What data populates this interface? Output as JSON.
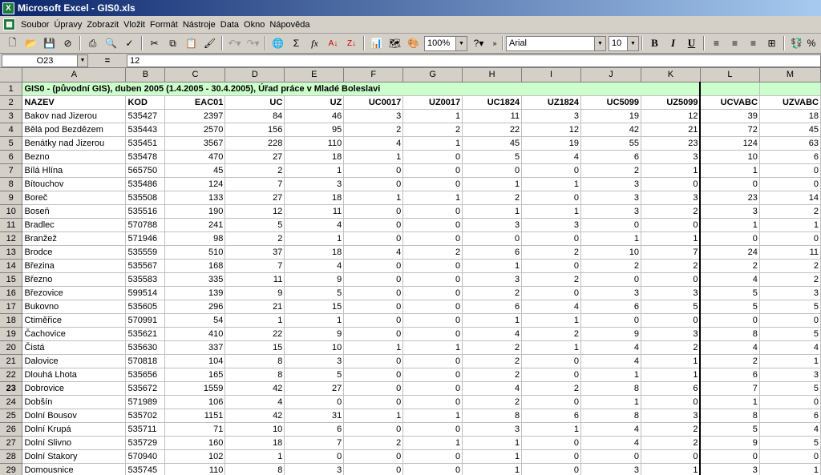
{
  "window": {
    "title": "Microsoft Excel - GIS0.xls",
    "icon": "excel-icon"
  },
  "menu": [
    "Soubor",
    "Úpravy",
    "Zobrazit",
    "Vložit",
    "Formát",
    "Nástroje",
    "Data",
    "Okno",
    "Nápověda"
  ],
  "toolbar": {
    "zoom": "100%",
    "font": "Arial",
    "size": "10",
    "bold": "B",
    "italic": "I",
    "underline": "U",
    "autosum": "Σ",
    "fx": "fx"
  },
  "formula_bar": {
    "cell_ref": "O23",
    "eq": "=",
    "value": "12"
  },
  "columns": [
    "A",
    "B",
    "C",
    "D",
    "E",
    "F",
    "G",
    "H",
    "I",
    "J",
    "K",
    "L",
    "M"
  ],
  "active_row": "23",
  "row1_title": "GIS0 - (původní GIS), duben 2005 (1.4.2005 - 30.4.2005), Úřad práce v Mladé Boleslavi",
  "headers": [
    "NAZEV",
    "KOD",
    "EAC01",
    "UC",
    "UZ",
    "UC0017",
    "UZ0017",
    "UC1824",
    "UZ1824",
    "UC5099",
    "UZ5099",
    "UCVABC",
    "UZVABC"
  ],
  "rows": [
    [
      "3",
      "Bakov nad Jizerou",
      "535427",
      "2397",
      "84",
      "46",
      "3",
      "1",
      "11",
      "3",
      "19",
      "12",
      "39",
      "18"
    ],
    [
      "4",
      "Bělá pod Bezdězem",
      "535443",
      "2570",
      "156",
      "95",
      "2",
      "2",
      "22",
      "12",
      "42",
      "21",
      "72",
      "45"
    ],
    [
      "5",
      "Benátky nad Jizerou",
      "535451",
      "3567",
      "228",
      "110",
      "4",
      "1",
      "45",
      "19",
      "55",
      "23",
      "124",
      "63"
    ],
    [
      "6",
      "Bezno",
      "535478",
      "470",
      "27",
      "18",
      "1",
      "0",
      "5",
      "4",
      "6",
      "3",
      "10",
      "6"
    ],
    [
      "7",
      "Bílá Hlína",
      "565750",
      "45",
      "2",
      "1",
      "0",
      "0",
      "0",
      "0",
      "2",
      "1",
      "1",
      "0"
    ],
    [
      "8",
      "Bítouchov",
      "535486",
      "124",
      "7",
      "3",
      "0",
      "0",
      "1",
      "1",
      "3",
      "0",
      "0",
      "0"
    ],
    [
      "9",
      "Boreč",
      "535508",
      "133",
      "27",
      "18",
      "1",
      "1",
      "2",
      "0",
      "3",
      "3",
      "23",
      "14"
    ],
    [
      "10",
      "Boseň",
      "535516",
      "190",
      "12",
      "11",
      "0",
      "0",
      "1",
      "1",
      "3",
      "2",
      "3",
      "2"
    ],
    [
      "11",
      "Bradlec",
      "570788",
      "241",
      "5",
      "4",
      "0",
      "0",
      "3",
      "3",
      "0",
      "0",
      "1",
      "1"
    ],
    [
      "12",
      "Branžež",
      "571946",
      "98",
      "2",
      "1",
      "0",
      "0",
      "0",
      "0",
      "1",
      "1",
      "0",
      "0"
    ],
    [
      "13",
      "Brodce",
      "535559",
      "510",
      "37",
      "18",
      "4",
      "2",
      "6",
      "2",
      "10",
      "7",
      "24",
      "11"
    ],
    [
      "14",
      "Březina",
      "535567",
      "168",
      "7",
      "4",
      "0",
      "0",
      "1",
      "0",
      "2",
      "2",
      "2",
      "2"
    ],
    [
      "15",
      "Březno",
      "535583",
      "335",
      "11",
      "9",
      "0",
      "0",
      "3",
      "2",
      "0",
      "0",
      "4",
      "2"
    ],
    [
      "16",
      "Březovice",
      "599514",
      "139",
      "9",
      "5",
      "0",
      "0",
      "2",
      "0",
      "3",
      "3",
      "5",
      "3"
    ],
    [
      "17",
      "Bukovno",
      "535605",
      "296",
      "21",
      "15",
      "0",
      "0",
      "6",
      "4",
      "6",
      "5",
      "5",
      "5"
    ],
    [
      "18",
      "Ctiměřice",
      "570991",
      "54",
      "1",
      "1",
      "0",
      "0",
      "1",
      "1",
      "0",
      "0",
      "0",
      "0"
    ],
    [
      "19",
      "Čachovice",
      "535621",
      "410",
      "22",
      "9",
      "0",
      "0",
      "4",
      "2",
      "9",
      "3",
      "8",
      "5"
    ],
    [
      "20",
      "Čistá",
      "535630",
      "337",
      "15",
      "10",
      "1",
      "1",
      "2",
      "1",
      "4",
      "2",
      "4",
      "4"
    ],
    [
      "21",
      "Dalovice",
      "570818",
      "104",
      "8",
      "3",
      "0",
      "0",
      "2",
      "0",
      "4",
      "1",
      "2",
      "1"
    ],
    [
      "22",
      "Dlouhá Lhota",
      "535656",
      "165",
      "8",
      "5",
      "0",
      "0",
      "2",
      "0",
      "1",
      "1",
      "6",
      "3"
    ],
    [
      "23",
      "Dobrovice",
      "535672",
      "1559",
      "42",
      "27",
      "0",
      "0",
      "4",
      "2",
      "8",
      "6",
      "7",
      "5"
    ],
    [
      "24",
      "Dobšín",
      "571989",
      "106",
      "4",
      "0",
      "0",
      "0",
      "2",
      "0",
      "1",
      "0",
      "1",
      "0"
    ],
    [
      "25",
      "Dolní Bousov",
      "535702",
      "1151",
      "42",
      "31",
      "1",
      "1",
      "8",
      "6",
      "8",
      "3",
      "8",
      "6"
    ],
    [
      "26",
      "Dolní Krupá",
      "535711",
      "71",
      "10",
      "6",
      "0",
      "0",
      "3",
      "1",
      "4",
      "2",
      "5",
      "4"
    ],
    [
      "27",
      "Dolní Slivno",
      "535729",
      "160",
      "18",
      "7",
      "2",
      "1",
      "1",
      "0",
      "4",
      "2",
      "9",
      "5"
    ],
    [
      "28",
      "Dolní Stakory",
      "570940",
      "102",
      "1",
      "0",
      "0",
      "0",
      "1",
      "0",
      "0",
      "0",
      "0",
      "0"
    ],
    [
      "29",
      "Domousnice",
      "535745",
      "110",
      "8",
      "3",
      "0",
      "0",
      "1",
      "0",
      "3",
      "1",
      "3",
      "1"
    ]
  ]
}
